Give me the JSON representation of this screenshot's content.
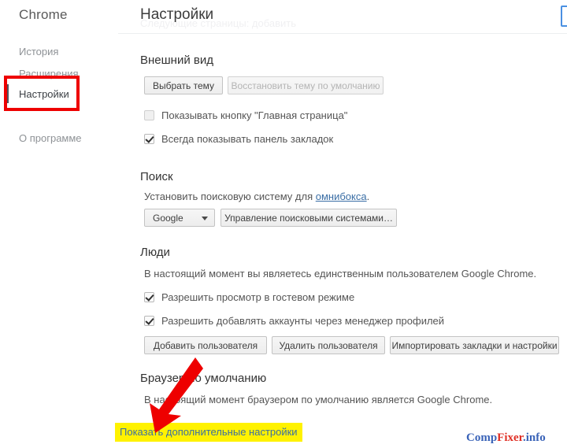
{
  "sidebar": {
    "brand": "Chrome",
    "items": [
      {
        "label": "История",
        "name": "history"
      },
      {
        "label": "Расширения",
        "name": "extensions"
      },
      {
        "label": "Настройки",
        "name": "settings"
      },
      {
        "label": "О программе",
        "name": "about"
      }
    ]
  },
  "header": {
    "title": "Настройки",
    "ghost_text": "Следующие страницы: добавить",
    "search_value": ""
  },
  "appearance": {
    "title": "Внешний вид",
    "choose_theme_button": "Выбрать тему",
    "reset_theme_button": "Восстановить тему по умолчанию",
    "show_home_button_label": "Показывать кнопку \"Главная страница\"",
    "show_bookmarks_bar_label": "Всегда показывать панель закладок"
  },
  "search_section": {
    "title": "Поиск",
    "description_prefix": "Установить поисковую систему для ",
    "description_link": "омнибокса",
    "description_suffix": ".",
    "engine_selected": "Google",
    "manage_engines_button": "Управление поисковыми системами…"
  },
  "people": {
    "title": "Люди",
    "description": "В настоящий момент вы являетесь единственным пользователем Google Chrome.",
    "guest_browsing_label": "Разрешить просмотр в гостевом режиме",
    "add_accounts_label": "Разрешить добавлять аккаунты через менеджер профилей",
    "add_user_button": "Добавить пользователя",
    "delete_user_button": "Удалить пользователя",
    "import_button": "Импортировать закладки и настройки"
  },
  "default_browser": {
    "title": "Браузер по умолчанию",
    "description": "В настоящий момент браузером по умолчанию является Google Chrome."
  },
  "advanced_link": "Показать дополнительные настройки",
  "watermark": {
    "part1": "Comp",
    "part2": "Fixer",
    "part3": ".info"
  },
  "colors": {
    "annotation_red": "#ee0000",
    "highlight_yellow": "#fff200",
    "link_blue": "#3a6ea5",
    "focus_blue": "#4a90e2"
  }
}
